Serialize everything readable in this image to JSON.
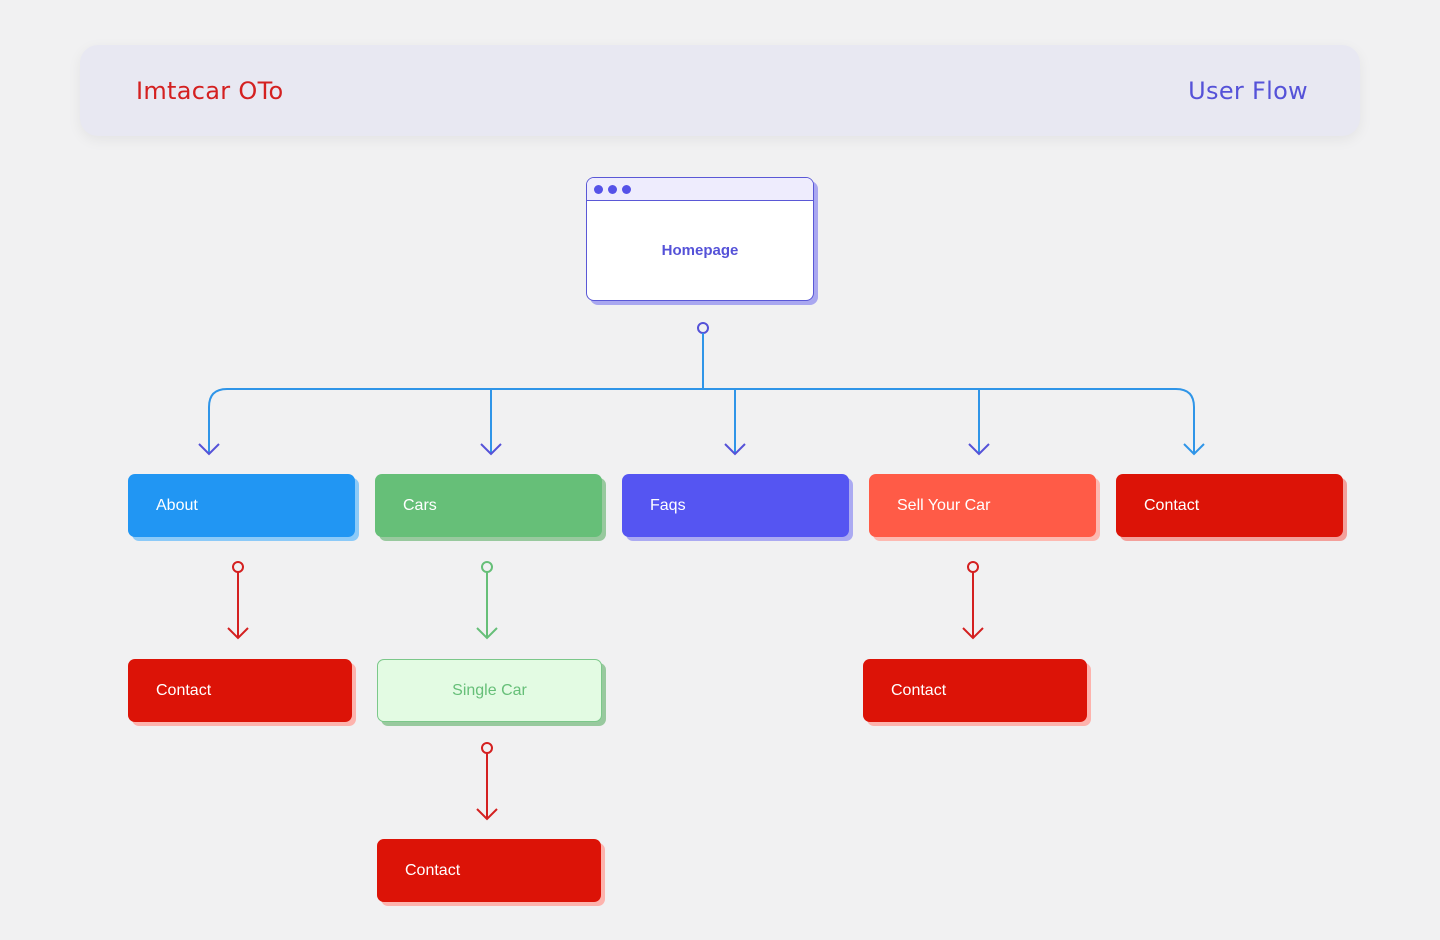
{
  "header": {
    "app_title": "Imtacar OTo",
    "page_label": "User Flow"
  },
  "colors": {
    "background": "#f1f1f2",
    "header_bg": "#e8e8f2",
    "brand_red": "#d42020",
    "accent_purple": "#5552d8",
    "connector_blue": "#2f95e8",
    "about_blue": "#2196f3",
    "cars_green": "#66bf78",
    "faqs_purple": "#5555f2",
    "sell_coral": "#ff5b47",
    "contact_red": "#dc1307",
    "single_car_bg": "#e3fbe3"
  },
  "root": {
    "label": "Homepage",
    "window_dots": 3
  },
  "level1": [
    {
      "id": "about",
      "label": "About"
    },
    {
      "id": "cars",
      "label": "Cars"
    },
    {
      "id": "faqs",
      "label": "Faqs"
    },
    {
      "id": "sell",
      "label": "Sell Your Car"
    },
    {
      "id": "contact",
      "label": "Contact"
    }
  ],
  "level2": [
    {
      "parent": "about",
      "label": "Contact"
    },
    {
      "parent": "cars",
      "label": "Single Car"
    },
    {
      "parent": "sell",
      "label": "Contact"
    }
  ],
  "level3": [
    {
      "parent": "single-car",
      "label": "Contact"
    }
  ]
}
